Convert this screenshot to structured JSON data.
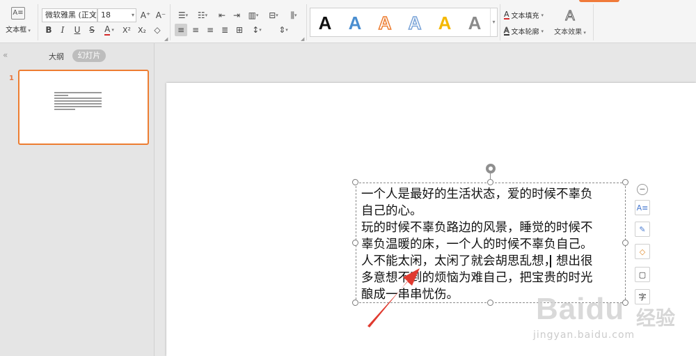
{
  "ribbon": {
    "textbox_label": "文本框",
    "textbox_icon_glyph": "A≡",
    "font_name": "微软雅黑 (正文",
    "font_size": "18",
    "grow_font": "A⁺",
    "shrink_font": "A⁻",
    "bold": "B",
    "italic": "I",
    "underline": "U",
    "strike": "S",
    "font_color": "A",
    "superscript": "X²",
    "subscript": "X₂",
    "eraser": "◇",
    "text_fill": "文本填充",
    "text_outline": "文本轮廓",
    "text_effect": "文本效果",
    "gallery_letter": "A",
    "gallery_colors": [
      "#111111",
      "#4a8ed0",
      "#ed7d31",
      "#a9c4e4",
      "#f4b800",
      "#8a8a8a"
    ]
  },
  "left_pane": {
    "collapse_glyph": "«",
    "tab_outline": "大纲",
    "tab_slides": "幻灯片",
    "slide_number": "1"
  },
  "textbox": {
    "lines": [
      "一个人是最好的生活状态，爱的时候不辜负",
      "自己的心。",
      "玩的时候不辜负路边的风景，睡觉的时候不",
      "辜负温暖的床，一个人的时候不辜负自己。",
      "人不能太闲，太闲了就会胡思乱想，想出很",
      "多意想不到的烦恼为难自己，把宝贵的时光",
      "酿成一串串忧伤。"
    ]
  },
  "float_toolbar": {
    "minus": "−",
    "items": [
      "A≡",
      "✎",
      "◇",
      "▢",
      "字"
    ]
  },
  "watermark": {
    "logo": "Baidu",
    "logo_cn": "经验",
    "url": "jingyan.baidu.com"
  },
  "colors": {
    "accent": "#ed7d31",
    "arrow": "#e03a2f",
    "font_color_bar": "#d42a2a"
  }
}
